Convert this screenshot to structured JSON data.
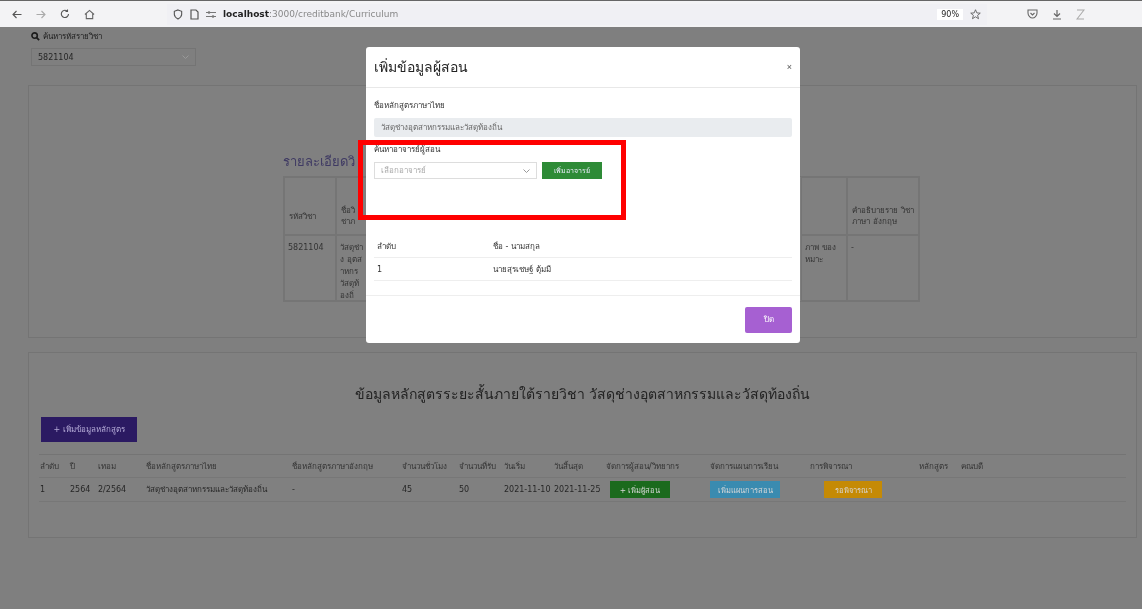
{
  "browser": {
    "url_host": "localhost",
    "url_rest": ":3000/creditbank/Curriculum",
    "zoom": "90%"
  },
  "search": {
    "label": "ค้นหารหัสรายวิชา",
    "value": "5821104"
  },
  "detail": {
    "title": "รายละเอียดวิ",
    "left_columns": [
      "รหัสวิชา",
      "ชื่อวิชาภ"
    ],
    "left_row": [
      "5821104",
      "วัสดุช่าง อุตสาหกร วัสดุท้องถิ่"
    ],
    "right_columns": [
      "",
      "คำอธิบายราย วิชาภาษา อังกฤษ"
    ],
    "right_row": [
      "ภาพ ของ หมาะ",
      "-"
    ]
  },
  "courses": {
    "title": "ข้อมูลหลักสูตรระยะสั้นภายใต้รายวิชา วัสดุช่างอุตสาหกรรมและวัสดุท้องถิ่น",
    "add_button": "+ เพิ่มข้อมูลหลักสูตร",
    "columns": [
      "ลำดับ",
      "ปี",
      "เทอม",
      "ชื่อหลักสูตรภาษาไทย",
      "ชื่อหลักสูตรภาษาอังกฤษ",
      "จำนวนชั่วโมง",
      "จำนวนที่รับ",
      "วันเริ่ม",
      "วันสิ้นสุด",
      "จัดการผู้สอน/วิทยากร",
      "จัดการแผนการเรียน",
      "การพิจารณา",
      "หลักสูตร",
      "คณบดี"
    ],
    "rows": [
      {
        "cells": [
          "1",
          "2564",
          "2/2564",
          "วัสดุช่างอุตสาหกรรมและวัสดุท้องถิ่น",
          "-",
          "45",
          "50",
          "2021-11-10",
          "2021-11-25"
        ],
        "actions": [
          {
            "kind": "add",
            "label": "+ เพิ่มผู้สอน"
          },
          {
            "kind": "plan",
            "label": "เพิ่มแผนการสอน"
          },
          {
            "kind": "status",
            "label": "รอพิจารณา"
          }
        ]
      }
    ]
  },
  "modal": {
    "title": "เพิ่มข้อมูลผู้สอน",
    "close": "×",
    "course_label": "ชื่อหลักสูตรภาษาไทย",
    "course_value": "วัสดุช่างอุตสาหกรรมและวัสดุท้องถิ่น",
    "teacher_label": "ค้นหาอาจารย์ผู้สอน",
    "teacher_placeholder": "เลือกอาจารย์",
    "add_teacher": "เพิ่มอาจารย์",
    "columns": [
      "ลำดับ",
      "ชื่อ - นามสกุล"
    ],
    "rows": [
      [
        "1",
        "นายสุรเชษฐ์ ตุ้มมี"
      ]
    ],
    "close_button": "ปิด"
  }
}
